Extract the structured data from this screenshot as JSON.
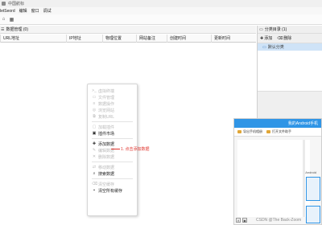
{
  "window": {
    "title": "中国航标"
  },
  "menubar": {
    "items": [
      "letSeord",
      "编辑",
      "窗口",
      "调试"
    ]
  },
  "left_panel": {
    "title": "数据管理 (0)",
    "columns": [
      "URL地址",
      "IP地址",
      "物理位置",
      "网站备注",
      "创建时间",
      "更新时间"
    ]
  },
  "right_panel": {
    "title": "分类目录 (1)",
    "add_label": "添加",
    "delete_label": "删除",
    "group": "默认分类"
  },
  "context_menu": {
    "items": [
      {
        "label": "虚拟终端",
        "icon": "terminal-icon",
        "enabled": false
      },
      {
        "label": "文件管理",
        "icon": "folder-icon",
        "enabled": false
      },
      {
        "label": "数据操作",
        "icon": "database-icon",
        "enabled": false
      },
      {
        "label": "浏览网站",
        "icon": "globe-icon",
        "enabled": false
      },
      {
        "label": "复制URL",
        "icon": "copy-icon",
        "enabled": false
      },
      {
        "label": "加载插件",
        "icon": "plugin-icon",
        "enabled": false
      },
      {
        "label": "插件市场",
        "icon": "market-icon",
        "enabled": true
      },
      {
        "label": "添加数据",
        "icon": "add-icon",
        "enabled": true
      },
      {
        "label": "编辑数据",
        "icon": "edit-icon",
        "enabled": false
      },
      {
        "label": "删除数据",
        "icon": "delete-icon",
        "enabled": false
      },
      {
        "label": "移动数据",
        "icon": "move-icon",
        "enabled": false
      },
      {
        "label": "搜索数据",
        "icon": "search-icon",
        "enabled": true
      },
      {
        "label": "清空缓存",
        "icon": "clear-icon",
        "enabled": false
      },
      {
        "label": "清空所有缓存",
        "icon": "clear-all-icon",
        "enabled": true
      }
    ],
    "annotation": "1. 点击添加数据"
  },
  "phone_window": {
    "title": "我的Android手机",
    "tabs": [
      "导出手机相册",
      "打开文件助手"
    ],
    "label": "Android"
  },
  "watermark": "CSDN @The Back-Zoom"
}
